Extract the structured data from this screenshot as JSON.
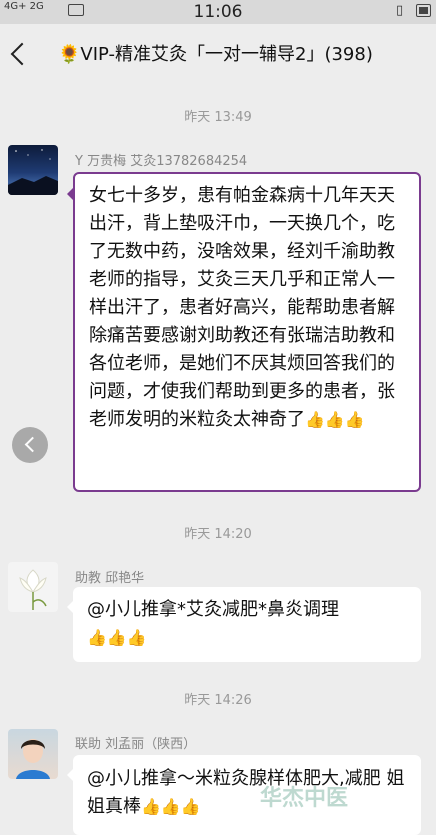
{
  "status_bar": {
    "signal_text": "4G+ 2G",
    "time": "11:06"
  },
  "header": {
    "sunflower": "🌻",
    "title": "VIP-精准艾灸「一对一辅导2」(398)"
  },
  "messages": [
    {
      "timestamp": "昨天 13:49",
      "sender": "Y 万贵梅 艾灸13782684254",
      "text": "女七十多岁，患有帕金森病十几年天天出汗，背上垫吸汗巾，一天换几个，吃了无数中药，没啥效果，经刘千渝助教老师的指导，艾灸三天几乎和正常人一样出汗了，患者好高兴，能帮助患者解除痛苦要感谢刘助教还有张瑞洁助教和各位老师，是她们不厌其烦回答我们的问题，才使我们帮助到更多的患者，张老师发明的米粒灸太神奇了",
      "emoji": "👍👍👍"
    },
    {
      "timestamp": "昨天 14:20",
      "sender": "助教  邱艳华",
      "text": "@小儿推拿*艾灸减肥*鼻炎调理",
      "emoji": "👍👍👍"
    },
    {
      "timestamp": "昨天 14:26",
      "sender": "联助  刘孟丽（陕西）",
      "text": "@小儿推拿～米粒灸腺样体肥大,减肥  姐姐真棒",
      "emoji": "👍👍👍"
    }
  ],
  "watermark": "华杰中医"
}
